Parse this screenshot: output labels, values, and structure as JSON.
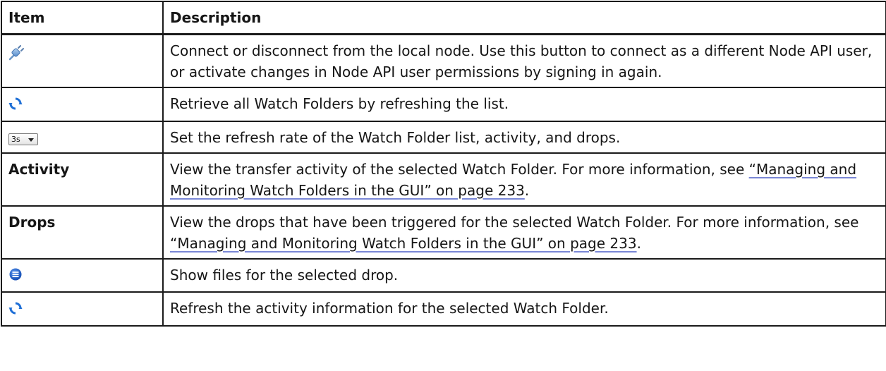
{
  "table": {
    "header": {
      "item": "Item",
      "description": "Description"
    },
    "rows": [
      {
        "item_icon": "connect-plug-icon",
        "description": "Connect or disconnect from the local node. Use this button to connect as a different Node API user, or activate changes in Node API user permissions by signing in again."
      },
      {
        "item_icon": "refresh-icon",
        "description": "Retrieve all Watch Folders by refreshing the list."
      },
      {
        "item_icon": "refresh-rate-dropdown",
        "dropdown_value": "3s",
        "description": "Set the refresh rate of the Watch Folder list, activity, and drops."
      },
      {
        "item": "Activity",
        "description_pre": "View the transfer activity of the selected Watch Folder. For more information, see ",
        "link": "“Managing and Monitoring Watch Folders in the GUI” on page 233",
        "description_post": "."
      },
      {
        "item": "Drops",
        "description_pre": "View the drops that have been triggered for the selected Watch Folder. For more information, see ",
        "link": "“Managing and Monitoring Watch Folders in the GUI” on page 233",
        "description_post": "."
      },
      {
        "item_icon": "show-files-icon",
        "description": "Show files for the selected drop."
      },
      {
        "item_icon": "refresh-icon",
        "description": "Refresh the activity information for the selected Watch Folder."
      }
    ]
  },
  "colors": {
    "icon_blue": "#1f6fd6",
    "link_underline": "#7a87d6"
  }
}
